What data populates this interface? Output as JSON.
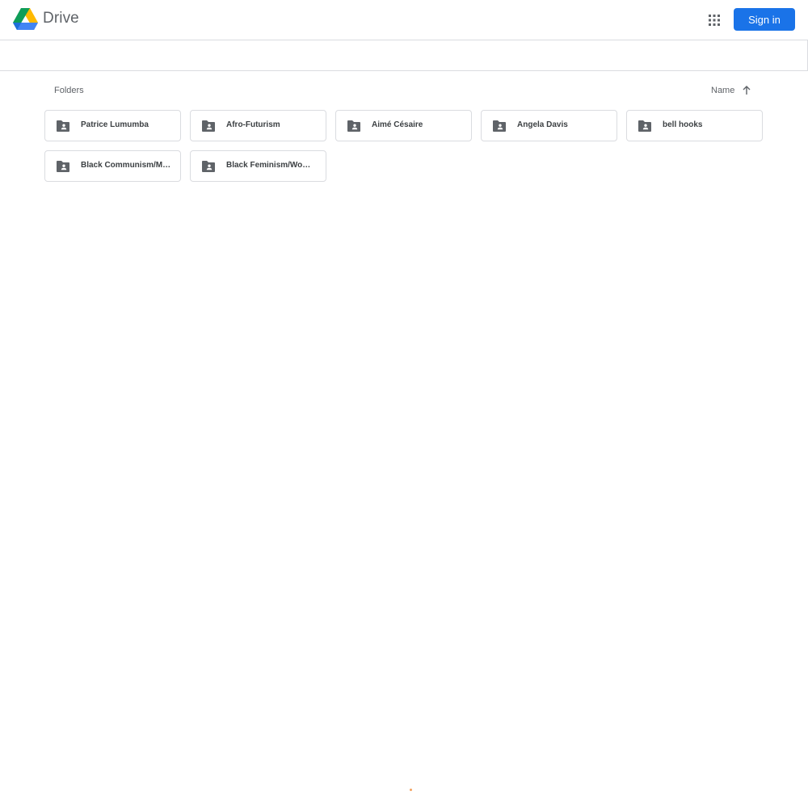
{
  "header": {
    "app_title": "Drive",
    "logo_icon": "google-drive-logo",
    "apps_icon": "apps-grid-icon",
    "signin_label": "Sign in",
    "accent_color": "#1a73e8"
  },
  "content": {
    "section_label": "Folders",
    "sort": {
      "label": "Name",
      "icon": "arrow-upward-icon"
    },
    "folders": [
      {
        "name": "Patrice Lumumba",
        "icon": "shared-folder-icon"
      },
      {
        "name": "Afro-Futurism",
        "icon": "shared-folder-icon"
      },
      {
        "name": "Aimé Césaire",
        "icon": "shared-folder-icon"
      },
      {
        "name": "Angela Davis",
        "icon": "shared-folder-icon"
      },
      {
        "name": "bell hooks",
        "icon": "shared-folder-icon"
      },
      {
        "name": "Black Communism/Marxism",
        "icon": "shared-folder-icon"
      },
      {
        "name": "Black Feminism/Womanism",
        "icon": "shared-folder-icon"
      }
    ]
  }
}
